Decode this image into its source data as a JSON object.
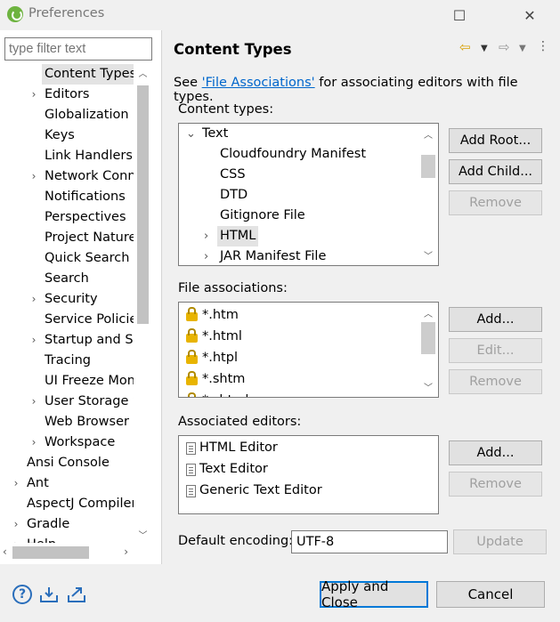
{
  "window": {
    "title": "Preferences",
    "minimize": "—",
    "maximize": "☐",
    "close": "✕"
  },
  "filter": {
    "placeholder": "type filter text"
  },
  "tree": [
    {
      "label": "Content Types",
      "arrow": "",
      "indent": 1,
      "selected": true
    },
    {
      "label": "Editors",
      "arrow": "›",
      "indent": 1
    },
    {
      "label": "Globalization",
      "arrow": "",
      "indent": 1
    },
    {
      "label": "Keys",
      "arrow": "",
      "indent": 1
    },
    {
      "label": "Link Handlers",
      "arrow": "",
      "indent": 1
    },
    {
      "label": "Network Conn",
      "arrow": "›",
      "indent": 1
    },
    {
      "label": "Notifications",
      "arrow": "",
      "indent": 1
    },
    {
      "label": "Perspectives",
      "arrow": "",
      "indent": 1
    },
    {
      "label": "Project Natures",
      "arrow": "",
      "indent": 1
    },
    {
      "label": "Quick Search",
      "arrow": "",
      "indent": 1
    },
    {
      "label": "Search",
      "arrow": "",
      "indent": 1
    },
    {
      "label": "Security",
      "arrow": "›",
      "indent": 1
    },
    {
      "label": "Service Policies",
      "arrow": "",
      "indent": 1
    },
    {
      "label": "Startup and Sh",
      "arrow": "›",
      "indent": 1
    },
    {
      "label": "Tracing",
      "arrow": "",
      "indent": 1
    },
    {
      "label": "UI Freeze Mon",
      "arrow": "",
      "indent": 1
    },
    {
      "label": "User Storage S",
      "arrow": "›",
      "indent": 1
    },
    {
      "label": "Web Browser",
      "arrow": "",
      "indent": 1
    },
    {
      "label": "Workspace",
      "arrow": "›",
      "indent": 1
    },
    {
      "label": "Ansi Console",
      "arrow": "",
      "indent": 0
    },
    {
      "label": "Ant",
      "arrow": "›",
      "indent": 0
    },
    {
      "label": "AspectJ Compiler",
      "arrow": "",
      "indent": 0
    },
    {
      "label": "Gradle",
      "arrow": "›",
      "indent": 0
    },
    {
      "label": "Help",
      "arrow": "›",
      "indent": 0
    }
  ],
  "page": {
    "title": "Content Types",
    "desc_prefix": "See ",
    "desc_link": "'File Associations'",
    "desc_suffix": " for associating editors with file types.",
    "content_types_label": "Content types:",
    "content_types": [
      {
        "label": "Text",
        "arrow": "⌄",
        "level": 0
      },
      {
        "label": "Cloudfoundry Manifest",
        "arrow": "",
        "level": 1
      },
      {
        "label": "CSS",
        "arrow": "",
        "level": 1
      },
      {
        "label": "DTD",
        "arrow": "",
        "level": 1
      },
      {
        "label": "Gitignore File",
        "arrow": "",
        "level": 1
      },
      {
        "label": "HTML",
        "arrow": "›",
        "level": 1,
        "selected": true
      },
      {
        "label": "JAR Manifest File",
        "arrow": "›",
        "level": 1
      }
    ],
    "add_root": "Add Root...",
    "add_child": "Add Child...",
    "remove1": "Remove",
    "file_assoc_label": "File associations:",
    "file_assocs": [
      "*.htm",
      "*.html",
      "*.htpl",
      "*.shtm",
      "*.shtml"
    ],
    "add2": "Add...",
    "edit2": "Edit...",
    "remove2": "Remove",
    "assoc_editors_label": "Associated editors:",
    "editors": [
      "HTML Editor",
      "Text Editor",
      "Generic Text Editor"
    ],
    "add3": "Add...",
    "remove3": "Remove",
    "encoding_label": "Default encoding:",
    "encoding_value": "UTF-8",
    "update": "Update"
  },
  "footer": {
    "apply_close": "Apply and Close",
    "cancel": "Cancel",
    "help_icon": "?"
  }
}
